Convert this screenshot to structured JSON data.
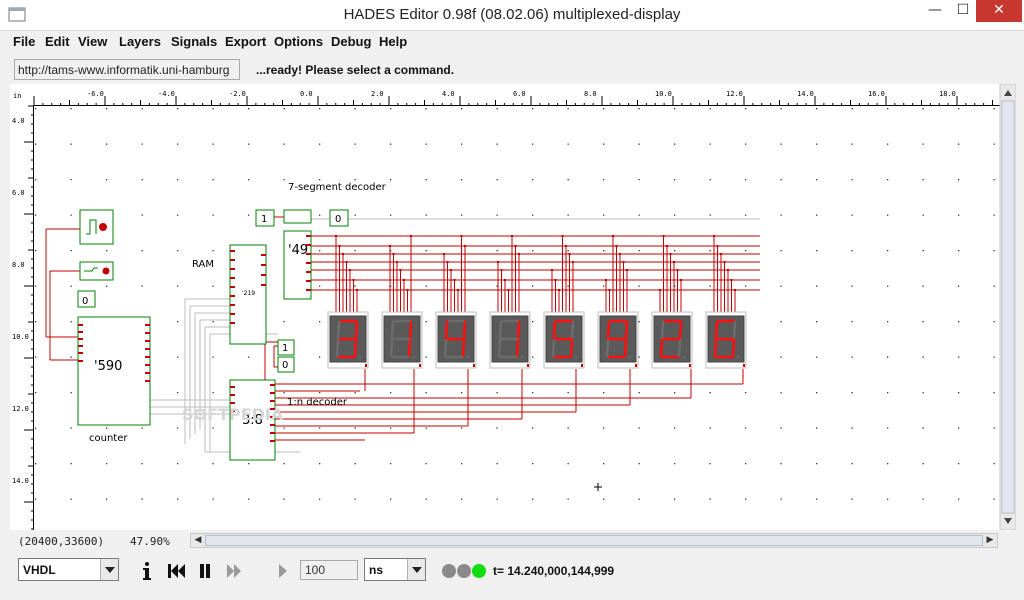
{
  "window": {
    "title": "HADES Editor 0.98f (08.02.06)   multiplexed-display",
    "minimize_glyph": "—",
    "maximize_glyph": "☐",
    "close_glyph": "✕"
  },
  "menu": [
    "File",
    "Edit",
    "View",
    "Layers",
    "Signals",
    "Export",
    "Options",
    "Debug",
    "Help"
  ],
  "toolbar": {
    "url": "http://tams-www.informatik.uni-hamburg",
    "status": "...ready! Please select a command."
  },
  "ruler": {
    "unit": "in",
    "x_labels": [
      "-6.0",
      "-4.0",
      "-2.0",
      "0.0",
      "2.0",
      "4.0",
      "6.0",
      "8.0",
      "10.0",
      "12.0",
      "14.0",
      "16.0",
      "18.0"
    ],
    "y_labels": [
      "4.0",
      "6.0",
      "8.0",
      "10.0",
      "12.0",
      "14.0"
    ]
  },
  "schematic": {
    "labels": {
      "seg_decoder": "7-segment decoder",
      "ram": "RAM",
      "counter": "counter",
      "chip_590": "'590",
      "chip_49": "'49",
      "chip_219": "'219",
      "decoder_38": "3:8",
      "one_n_decoder": "1:n decoder",
      "watermark": "SOFTPEDIA"
    },
    "constants": [
      "1",
      "0",
      "0",
      "1",
      "0"
    ],
    "digits": [
      "3",
      "1",
      "4",
      "1",
      "5",
      "9",
      "2",
      "6"
    ],
    "colors": {
      "wire": "#c00000",
      "component": "#008000",
      "display_bg": "#5a5a5a",
      "segment_on": "#ff1010",
      "segment_off": "#6c6c6c"
    }
  },
  "status": {
    "coords": "(20400,33600)",
    "zoom": "47.90%"
  },
  "controls": {
    "language": "VHDL",
    "step_value": "100",
    "time_unit": "ns",
    "time": "t= 14.240,000,144,999",
    "led_colors": [
      "#8a8a8a",
      "#8a8a8a",
      "#11dd11"
    ]
  }
}
